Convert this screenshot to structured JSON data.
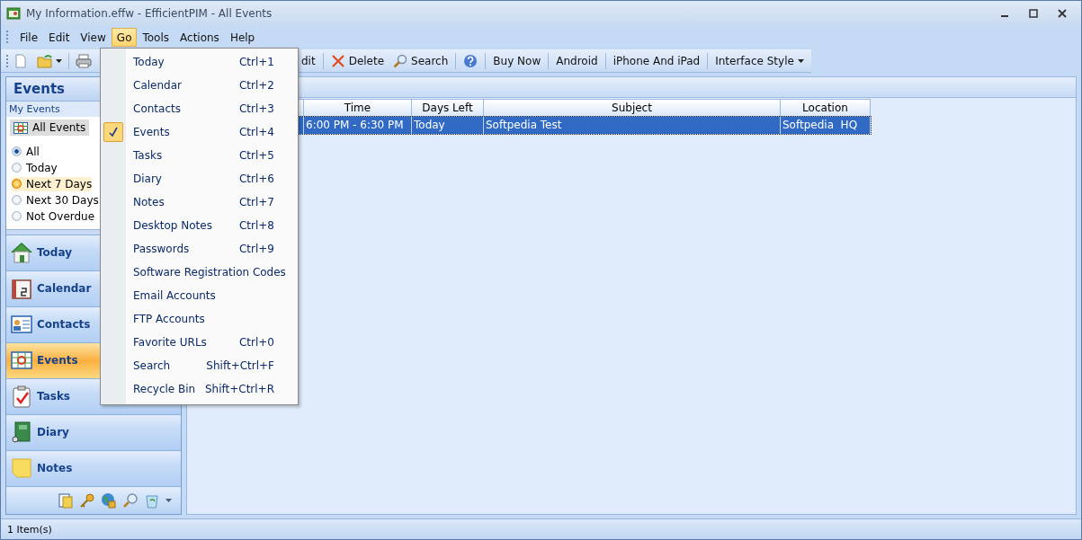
{
  "window": {
    "title": "My Information.effw - EfficientPIM - All Events"
  },
  "menubar": {
    "items": [
      {
        "label": "File",
        "open": false
      },
      {
        "label": "Edit",
        "open": false
      },
      {
        "label": "View",
        "open": false
      },
      {
        "label": "Go",
        "open": true
      },
      {
        "label": "Tools",
        "open": false
      },
      {
        "label": "Actions",
        "open": false
      },
      {
        "label": "Help",
        "open": false
      }
    ]
  },
  "toolbar": {
    "buttons": [
      {
        "label": "dit",
        "dropdown": false
      },
      {
        "label": "Delete",
        "dropdown": false
      },
      {
        "label": "Search",
        "dropdown": false
      },
      {
        "label": "Buy Now",
        "dropdown": false
      },
      {
        "label": "Android",
        "dropdown": false
      },
      {
        "label": "iPhone And iPad",
        "dropdown": false
      },
      {
        "label": "Interface Style",
        "dropdown": true
      }
    ]
  },
  "sidebar": {
    "title": "Events",
    "section": "My Events",
    "view": "All Events",
    "filters": [
      {
        "label": "All",
        "selected": true,
        "highlighted": false
      },
      {
        "label": "Today",
        "selected": false,
        "highlighted": false
      },
      {
        "label": "Next 7 Days",
        "selected": false,
        "highlighted": true
      },
      {
        "label": "Next 30 Days",
        "selected": false,
        "highlighted": false
      },
      {
        "label": "Not Overdue",
        "selected": false,
        "highlighted": false
      }
    ],
    "nav": [
      {
        "label": "Today",
        "selected": false
      },
      {
        "label": "Calendar",
        "selected": false
      },
      {
        "label": "Contacts",
        "selected": false
      },
      {
        "label": "Events",
        "selected": true
      },
      {
        "label": "Tasks",
        "selected": false
      },
      {
        "label": "Diary",
        "selected": false
      },
      {
        "label": "Notes",
        "selected": false
      }
    ]
  },
  "table": {
    "columns": [
      "Time",
      "Days Left",
      "Subject",
      "Location"
    ],
    "rows": [
      {
        "cells": [
          "6:00 PM - 6:30 PM",
          "Today",
          "Softpedia Test",
          "Softpedia  HQ"
        ],
        "selected": true
      }
    ]
  },
  "go_menu": {
    "items": [
      {
        "label": "Today",
        "shortcut": "Ctrl+1",
        "checked": false
      },
      {
        "label": "Calendar",
        "shortcut": "Ctrl+2",
        "checked": false
      },
      {
        "label": "Contacts",
        "shortcut": "Ctrl+3",
        "checked": false
      },
      {
        "label": "Events",
        "shortcut": "Ctrl+4",
        "checked": true
      },
      {
        "label": "Tasks",
        "shortcut": "Ctrl+5",
        "checked": false
      },
      {
        "label": "Diary",
        "shortcut": "Ctrl+6",
        "checked": false
      },
      {
        "label": "Notes",
        "shortcut": "Ctrl+7",
        "checked": false
      },
      {
        "label": "Desktop Notes",
        "shortcut": "Ctrl+8",
        "checked": false
      },
      {
        "label": "Passwords",
        "shortcut": "Ctrl+9",
        "checked": false
      },
      {
        "label": "Software Registration Codes",
        "checked": false
      },
      {
        "label": "Email Accounts",
        "checked": false
      },
      {
        "label": "FTP Accounts",
        "checked": false
      },
      {
        "label": "Favorite URLs",
        "shortcut": "Ctrl+0",
        "checked": false
      },
      {
        "label": "Search",
        "shortcut": "Shift+Ctrl+F",
        "checked": false
      },
      {
        "label": "Recycle Bin",
        "shortcut": "Shift+Ctrl+R",
        "checked": false
      }
    ]
  },
  "status_bar": {
    "text": "1 Item(s)"
  }
}
